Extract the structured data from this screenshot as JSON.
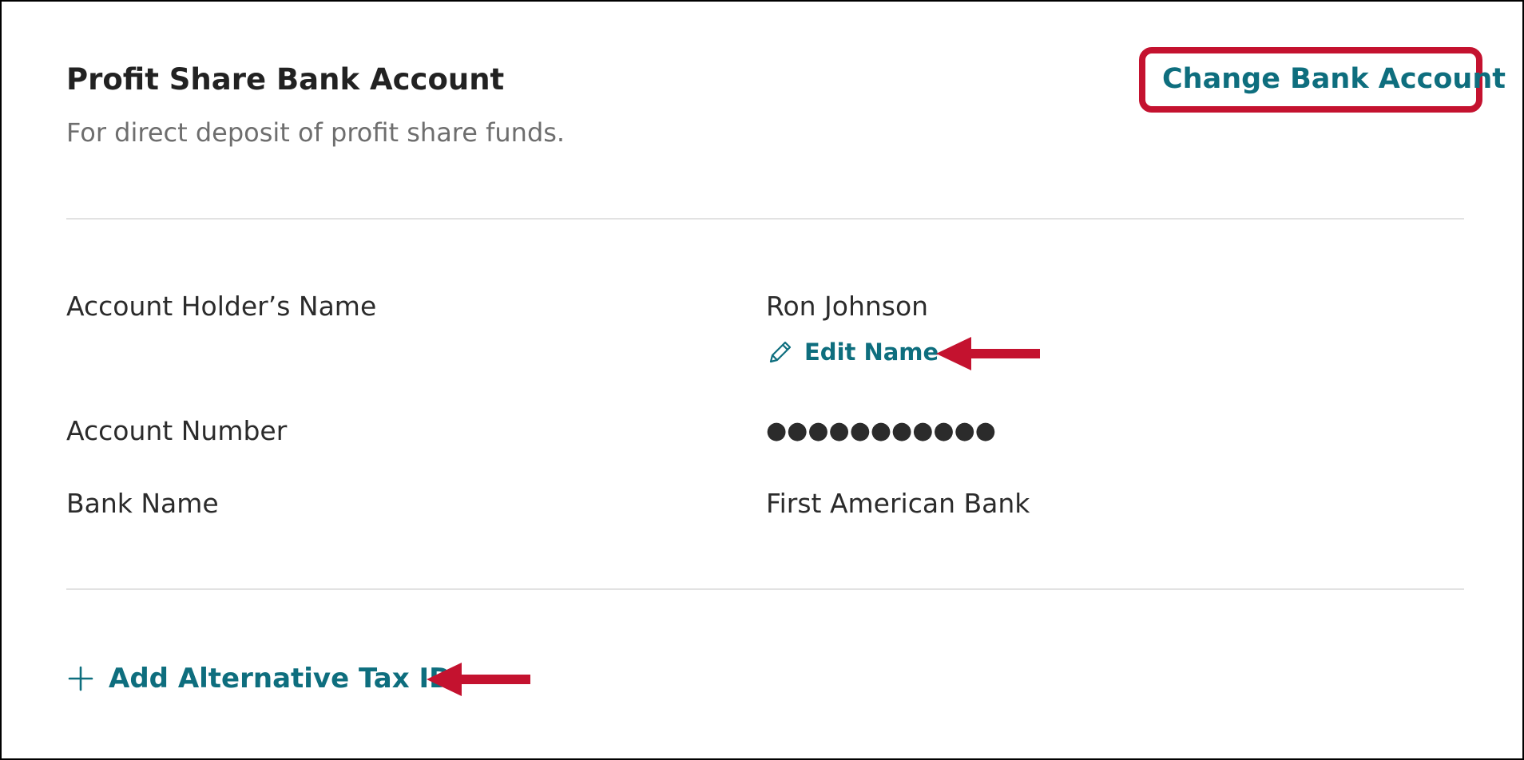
{
  "header": {
    "title": "Profit Share Bank Account",
    "subtitle": "For direct deposit of profit share funds.",
    "change_link": "Change Bank Account"
  },
  "details": {
    "rows": [
      {
        "label": "Account Holder’s Name",
        "value": "Ron Johnson"
      },
      {
        "label": "Account Number",
        "value": "●●●●●●●●●●●"
      },
      {
        "label": "Bank Name",
        "value": "First American Bank"
      }
    ],
    "edit_name_label": "Edit Name"
  },
  "footer": {
    "add_tax_id_label": "Add Alternative Tax ID"
  },
  "icons": {
    "edit": "pencil-icon",
    "add": "plus-icon",
    "annotation": "left-arrow-icon"
  },
  "colors": {
    "accent": "#0e6e7e",
    "highlight": "#c4122f",
    "text": "#2b2b2b",
    "muted": "#6e6e6e"
  }
}
